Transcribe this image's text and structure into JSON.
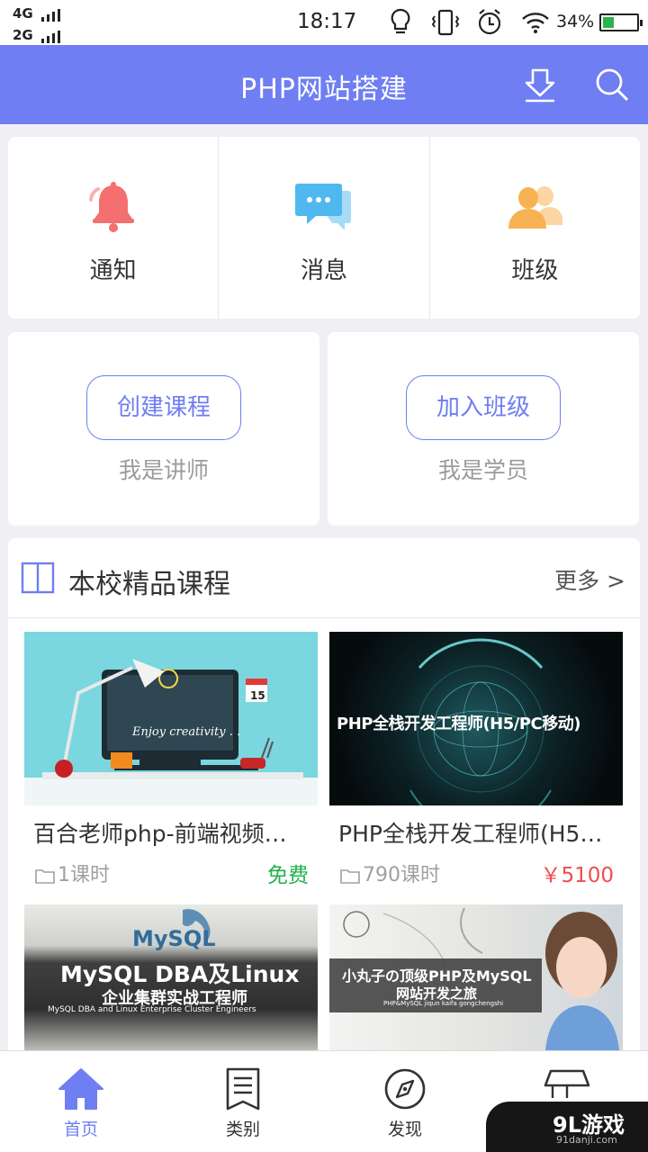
{
  "status_bar": {
    "net1": "4G",
    "net2": "2G",
    "time": "18:17",
    "battery": "34%",
    "battery_level": 0.34
  },
  "app_bar": {
    "title": "PHP网站搭建",
    "download_icon": "download-icon",
    "search_icon": "search-icon",
    "color": "#6f7ef2"
  },
  "quick_actions": [
    {
      "label": "通知",
      "icon": "bell-icon",
      "color": "#f46f6f"
    },
    {
      "label": "消息",
      "icon": "chat-icon",
      "color": "#4fb8ef"
    },
    {
      "label": "班级",
      "icon": "people-icon",
      "color": "#f7b353"
    }
  ],
  "roles": [
    {
      "button": "创建课程",
      "caption": "我是讲师"
    },
    {
      "button": "加入班级",
      "caption": "我是学员"
    }
  ],
  "courses_section": {
    "title": "本校精品课程",
    "more": "更多 >"
  },
  "courses": [
    {
      "name": "百合老师php-前端视频…",
      "lessons": "1课时",
      "price": "免费",
      "price_color": "#22b14c",
      "thumb_text": "Enjoy creativity . .",
      "thumb_badge": "15"
    },
    {
      "name": "PHP全栈开发工程师(H5…",
      "lessons": "790课时",
      "price": "￥5100",
      "price_color": "#f24c4c",
      "thumb_text": "PHP全栈开发工程师(H5/PC移动)"
    },
    {
      "thumb_logo": "MySQL",
      "thumb_title": "MySQL DBA及Linux",
      "thumb_subtitle": "企业集群实战工程师",
      "thumb_caption": "MySQL DBA and Linux Enterprise Cluster Engineers"
    },
    {
      "thumb_title": "小丸子の顶级PHP及MySQL",
      "thumb_subtitle": "网站开发之旅",
      "thumb_caption": "PHP&MySQL  jiqun kaifa gongchengshi"
    }
  ],
  "bottom_nav": [
    {
      "label": "首页",
      "icon": "home-icon",
      "active": true
    },
    {
      "label": "类别",
      "icon": "list-icon",
      "active": false
    },
    {
      "label": "发现",
      "icon": "compass-icon",
      "active": false
    },
    {
      "label": "",
      "icon": "cap-icon",
      "active": false
    }
  ],
  "watermark": {
    "brand": "9L游戏",
    "url": "91danji.com"
  }
}
